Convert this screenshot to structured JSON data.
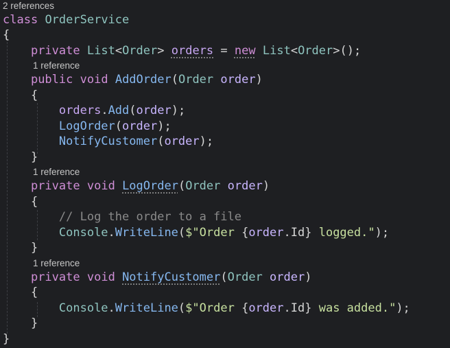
{
  "code": {
    "lens_2refs": "2 references",
    "lens_1ref": "1 reference",
    "class_kw": "class",
    "class_name": "OrderService",
    "open_brace": "{",
    "close_brace": "}",
    "private_kw": "private",
    "public_kw": "public",
    "void_kw": "void",
    "new_kw": "new",
    "list_type": "List",
    "lt": "<",
    "gt": ">",
    "order_type": "Order",
    "orders_field": "orders",
    "eq": " = ",
    "ctor_end": "();",
    "add_order_method": "AddOrder",
    "log_order_method": "LogOrder",
    "notify_customer_method": "NotifyCustomer",
    "order_param": "order",
    "paren_open": "(",
    "paren_close": ")",
    "stmt_end": ");",
    "dot": ".",
    "add_method": "Add",
    "comment": "// Log the order to a file",
    "console": "Console",
    "writeline": "WriteLine",
    "str_prefix": "$\"Order ",
    "interp_open": "{",
    "interp_close": "}",
    "id_prop": "Id",
    "logged_suffix": " logged.\"",
    "added_suffix": " was added.\""
  }
}
